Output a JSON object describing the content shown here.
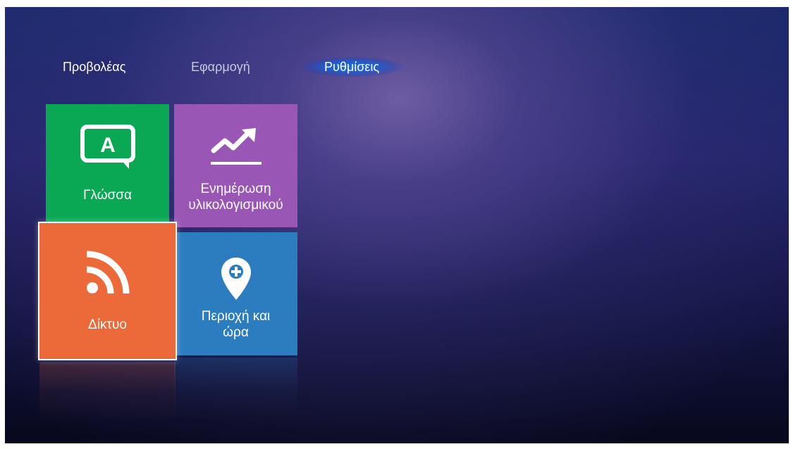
{
  "nav": {
    "tabs": [
      {
        "label": "Προβολέας",
        "active": false
      },
      {
        "label": "Εφαρμογή",
        "active": false
      },
      {
        "label": "Ρυθμίσεις",
        "active": true
      }
    ]
  },
  "tiles": {
    "language": {
      "label": "Γλώσσα",
      "icon": "language-icon",
      "color": "#0aa754"
    },
    "update": {
      "label_line1": "Ενημέρωση",
      "label_line2": "υλικολογισμικού",
      "icon": "trend-up-icon",
      "color": "#9a56b4"
    },
    "network": {
      "label": "Δίκτυο",
      "icon": "wifi-feed-icon",
      "color": "#ec6a3a",
      "selected": true
    },
    "region": {
      "label_line1": "Περιοχή και",
      "label_line2": "ώρα",
      "icon": "location-pin-icon",
      "color": "#2b7dc0"
    }
  },
  "icon_glyphs": {
    "language_letter": "A"
  }
}
